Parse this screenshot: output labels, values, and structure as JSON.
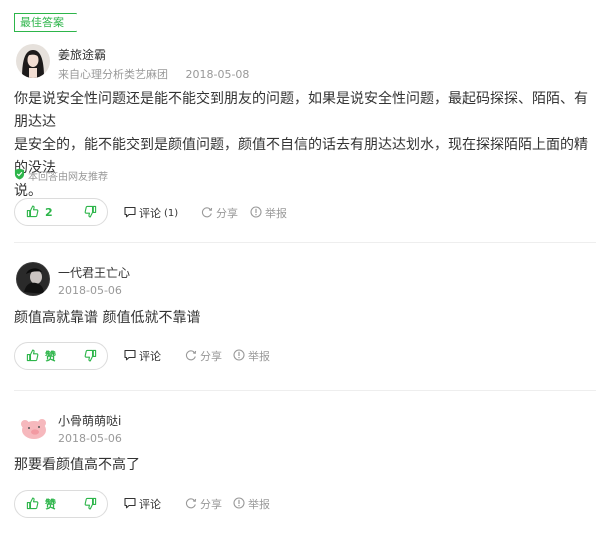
{
  "best_answer": {
    "badge": "最佳答案"
  },
  "answers": [
    {
      "username": "姜旅途霸",
      "source": "来自心理分析类艺麻团",
      "date": "2018-05-08",
      "content_lines": [
        "你是说安全性问题还是能不能交到朋友的问题，如果是说安全性问题，最起码探探、陌陌、有朋达达",
        "是安全的，能不能交到是颜值问题，颜值不自信的话去有朋达达划水，现在探探陌陌上面的精的没法",
        "说。"
      ],
      "recommend_note": "本回答由网友推荐",
      "like_label": "2",
      "comment_label": "评论",
      "comment_count": "(1)",
      "share_label": "分享",
      "report_label": "举报"
    },
    {
      "username": "一代君王亡心",
      "date": "2018-05-06",
      "content_lines": [
        "颜值高就靠谱 颜值低就不靠谱"
      ],
      "like_label": "赞",
      "comment_label": "评论",
      "share_label": "分享",
      "report_label": "举报"
    },
    {
      "username": "小骨萌萌哒i",
      "date": "2018-05-06",
      "content_lines": [
        "那要看颜值高不高了"
      ],
      "like_label": "赞",
      "comment_label": "评论",
      "share_label": "分享",
      "report_label": "举报"
    }
  ],
  "icons": {
    "like": "thumbs-up-icon",
    "dislike": "thumbs-down-icon",
    "comment": "comment-bubble-icon",
    "share": "share-icon",
    "report": "report-icon",
    "recommend": "shield-check-icon"
  },
  "colors": {
    "accent": "#2db54a",
    "muted": "#999999",
    "text": "#333333"
  }
}
